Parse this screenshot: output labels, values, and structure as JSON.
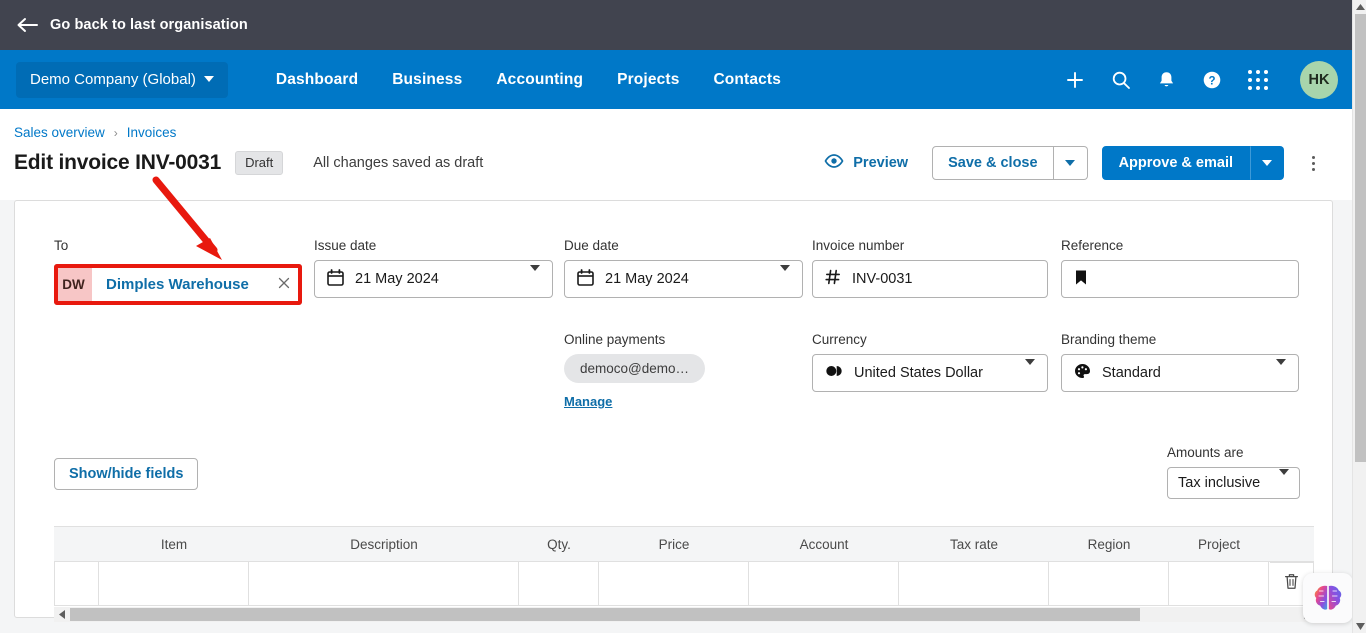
{
  "org_bar": {
    "back_label": "Go back to last organisation",
    "back_icon": "arrow-left-icon",
    "bg": "#41444f"
  },
  "navbar": {
    "org_name": "Demo Company (Global)",
    "links": [
      "Dashboard",
      "Business",
      "Accounting",
      "Projects",
      "Contacts"
    ],
    "icons": [
      "plus-icon",
      "search-icon",
      "bell-icon",
      "help-icon",
      "apps-grid-icon"
    ],
    "avatar_initials": "HK",
    "bg": "#0078c8",
    "avatar_bg": "#a8d5ac"
  },
  "breadcrumb": {
    "items": [
      "Sales overview",
      "Invoices"
    ],
    "separator": "›"
  },
  "header": {
    "title": "Edit invoice INV-0031",
    "status_badge": "Draft",
    "saved_text": "All changes saved as draft",
    "preview_label": "Preview",
    "preview_icon": "eye-icon",
    "save_close_label": "Save & close",
    "approve_email_label": "Approve & email",
    "kebab_icon": "more-vertical-icon"
  },
  "form": {
    "to": {
      "label": "To",
      "initials": "DW",
      "contact_name": "Dimples Warehouse",
      "clear_icon": "close-icon",
      "highlight_color": "#e8190e",
      "initials_bg": "#f7c6c6"
    },
    "issue_date": {
      "label": "Issue date",
      "value": "21 May 2024",
      "icon": "calendar-icon"
    },
    "due_date": {
      "label": "Due date",
      "value": "21 May 2024",
      "icon": "calendar-icon"
    },
    "invoice_number": {
      "label": "Invoice number",
      "value": "INV-0031",
      "icon": "hash-icon"
    },
    "reference": {
      "label": "Reference",
      "value": "",
      "icon": "bookmark-icon"
    },
    "online_payments": {
      "label": "Online payments",
      "pill_value": "democo@demo…",
      "manage_label": "Manage"
    },
    "currency": {
      "label": "Currency",
      "value": "United States Dollar",
      "icon": "currency-icon"
    },
    "branding_theme": {
      "label": "Branding theme",
      "value": "Standard",
      "icon": "palette-icon"
    },
    "show_hide_fields_label": "Show/hide fields",
    "amounts_are": {
      "label": "Amounts are",
      "value": "Tax inclusive"
    }
  },
  "line_items": {
    "columns": [
      "Item",
      "Description",
      "Qty.",
      "Price",
      "Account",
      "Tax rate",
      "Region",
      "Project"
    ],
    "rows": [
      {
        "item": "",
        "description": "",
        "qty": "",
        "price": "",
        "account": "",
        "tax_rate": "",
        "region": "",
        "project": ""
      }
    ],
    "delete_icon": "trash-icon"
  },
  "widgets": {
    "assistant_icon": "brain-icon"
  },
  "scrollbars": {
    "horizontal_left_icon": "caret-left-icon",
    "horizontal_right_icon": "caret-right-icon",
    "vertical_up_icon": "caret-up-icon",
    "vertical_down_icon": "caret-down-icon"
  }
}
